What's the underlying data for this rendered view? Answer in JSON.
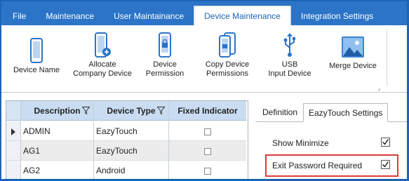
{
  "tabs": [
    {
      "label": "File"
    },
    {
      "label": "Maintenance"
    },
    {
      "label": "User Maintainance"
    },
    {
      "label": "Device Maintenance"
    },
    {
      "label": "Integration Settings"
    }
  ],
  "ribbon": {
    "buttons": [
      {
        "label": "Device Name",
        "icon": "phone-icon"
      },
      {
        "label": "Allocate\nCompany Device",
        "icon": "phone-add-icon"
      },
      {
        "label": "Device\nPermission",
        "icon": "phone-lock-icon"
      },
      {
        "label": "Copy Device\nPermissions",
        "icon": "copy-phone-icon"
      },
      {
        "label": "USB\nInput Device",
        "icon": "usb-icon"
      },
      {
        "label": "Merge Device",
        "icon": "image-icon"
      }
    ]
  },
  "grid": {
    "columns": [
      "Description",
      "Device Type",
      "Fixed Indicator"
    ],
    "rows": [
      {
        "description": "ADMIN",
        "device_type": "EazyTouch",
        "fixed": false
      },
      {
        "description": "AG1",
        "device_type": "EazyTouch",
        "fixed": false
      },
      {
        "description": "AG2",
        "device_type": "Android",
        "fixed": false
      }
    ]
  },
  "panel": {
    "tabs": [
      {
        "label": "Definition"
      },
      {
        "label": "EazyTouch Settings"
      }
    ],
    "settings": [
      {
        "label": "Show Minimize",
        "checked": true
      },
      {
        "label": "Exit Password Required",
        "checked": true
      }
    ]
  },
  "colors": {
    "accent": "#2b74c7",
    "highlight": "#e03a3a",
    "header": "#c9dcf1"
  }
}
